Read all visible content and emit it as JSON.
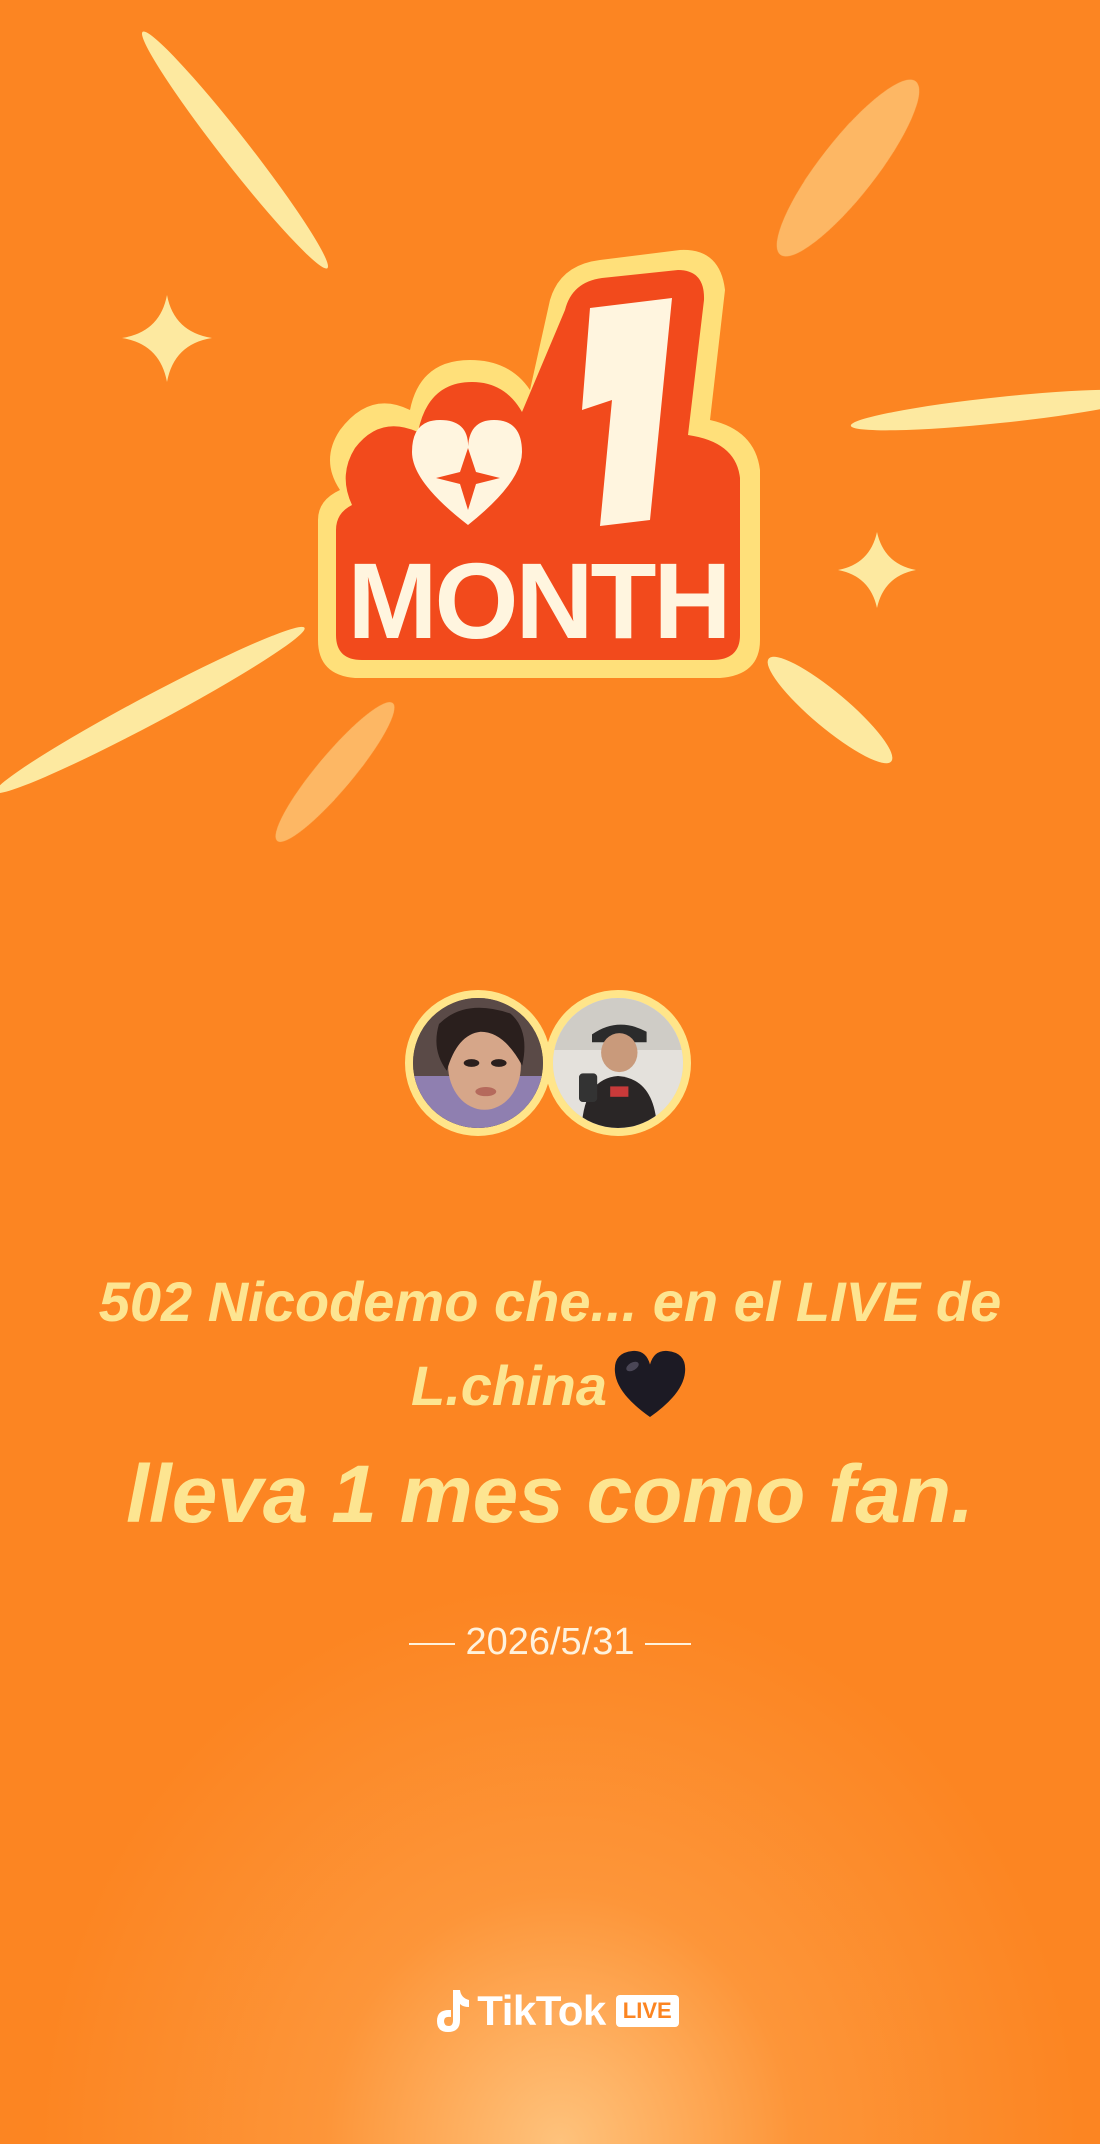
{
  "badge": {
    "number": "1",
    "label": "MONTH"
  },
  "message": {
    "line1": "502 Nicodemo che... en el LIVE de L.china",
    "line2": "lleva 1 mes como fan."
  },
  "date": "2026/5/31",
  "brand": {
    "name": "TikTok",
    "live_tag": "LIVE"
  },
  "colors": {
    "background": "#fc8522",
    "text_yellow": "#fde591",
    "badge_red": "#f24a1c",
    "badge_cream": "#fff5df"
  }
}
